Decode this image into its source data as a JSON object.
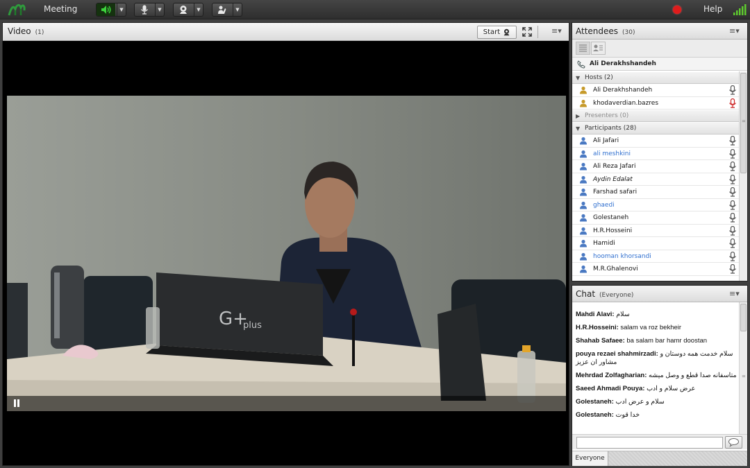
{
  "topbar": {
    "menu_meeting": "Meeting",
    "help": "Help",
    "icons": [
      "adobe-connect-logo",
      "speaker-icon",
      "microphone-icon",
      "webcam-icon",
      "raise-hand-icon",
      "record-dot",
      "signal-bars-icon"
    ],
    "colors": {
      "speaker_active": "#3cd23c",
      "record": "#e01c1c",
      "signal": "#5ecb2e"
    }
  },
  "video_pod": {
    "title": "Video",
    "count": "(1)",
    "start_label": "Start"
  },
  "attendees_pod": {
    "title": "Attendees",
    "count": "(30)",
    "presenter_name": "Ali Derakhshandeh",
    "groups": {
      "hosts": "Hosts (2)",
      "presenters": "Presenters (0)",
      "participants": "Participants (28)"
    },
    "hosts": [
      {
        "name": "Ali Derakhshandeh"
      },
      {
        "name": "khodaverdian.bazres"
      }
    ],
    "participants": [
      {
        "name": "Ali Jafari",
        "style": "normal"
      },
      {
        "name": "ali meshkini",
        "style": "blue"
      },
      {
        "name": "Ali Reza Jafari",
        "style": "normal"
      },
      {
        "name": "Aydin Edalat",
        "style": "italic"
      },
      {
        "name": "Farshad safari",
        "style": "normal"
      },
      {
        "name": "ghaedi",
        "style": "blue"
      },
      {
        "name": "Golestaneh",
        "style": "normal"
      },
      {
        "name": "H.R.Hosseini",
        "style": "normal"
      },
      {
        "name": "Hamidi",
        "style": "normal"
      },
      {
        "name": "hooman khorsandi",
        "style": "blue"
      },
      {
        "name": "M.R.Ghalenovi",
        "style": "normal"
      }
    ]
  },
  "chat_pod": {
    "title": "Chat",
    "scope": "(Everyone)",
    "messages": [
      {
        "sender": "Mahdi Alavi:",
        "text": "سلام"
      },
      {
        "sender": "H.R.Hosseini:",
        "text": "salam va roz bekheir"
      },
      {
        "sender": "Shahab Safaee:",
        "text": "ba salam bar hamr doostan"
      },
      {
        "sender": "pouya rezaei shahmirzadi:",
        "text": "سلام خدمت همه دوستان و مشاور ان عزیز"
      },
      {
        "sender": "Mehrdad Zolfagharian:",
        "text": "متاسفانه صدا قطع و وصل میشه"
      },
      {
        "sender": "Saeed Ahmadi Pouya:",
        "text": "عرض سلام و ادب"
      },
      {
        "sender": "Golestaneh:",
        "text": "سلام و عرض ادب"
      },
      {
        "sender": "Golestaneh:",
        "text": "خدا قوت"
      }
    ],
    "input_placeholder": "",
    "tab_everyone": "Everyone"
  }
}
